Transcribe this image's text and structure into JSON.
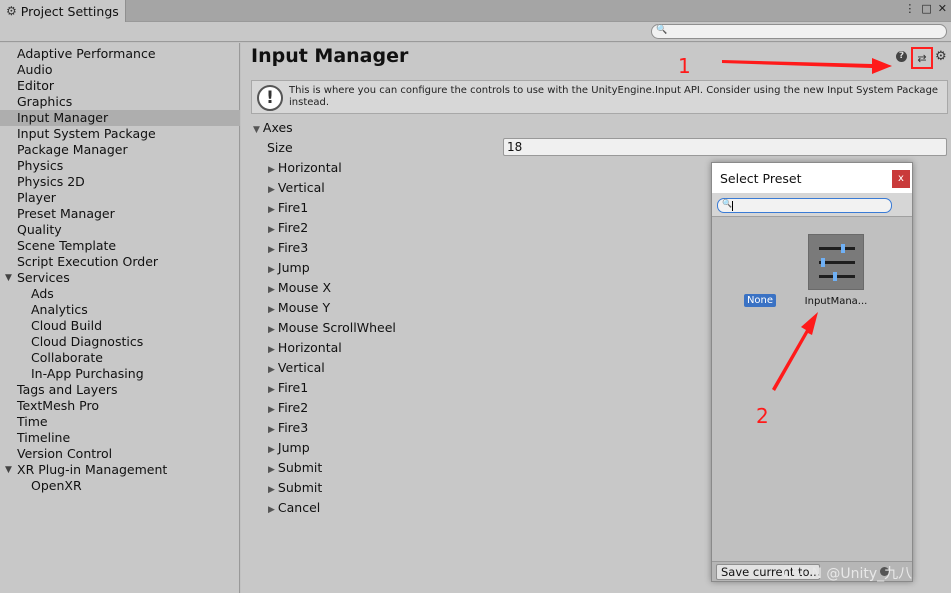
{
  "window": {
    "tab_title": "Project Settings",
    "tab_icon": "gear-icon",
    "controls": [
      "⋮",
      "□",
      "✕"
    ]
  },
  "search": {
    "placeholder": ""
  },
  "sidebar": {
    "items": [
      {
        "label": "Adaptive Performance",
        "indent": 0
      },
      {
        "label": "Audio",
        "indent": 0
      },
      {
        "label": "Editor",
        "indent": 0
      },
      {
        "label": "Graphics",
        "indent": 0
      },
      {
        "label": "Input Manager",
        "indent": 0,
        "selected": true
      },
      {
        "label": "Input System Package",
        "indent": 0
      },
      {
        "label": "Package Manager",
        "indent": 0
      },
      {
        "label": "Physics",
        "indent": 0
      },
      {
        "label": "Physics 2D",
        "indent": 0
      },
      {
        "label": "Player",
        "indent": 0
      },
      {
        "label": "Preset Manager",
        "indent": 0
      },
      {
        "label": "Quality",
        "indent": 0
      },
      {
        "label": "Scene Template",
        "indent": 0
      },
      {
        "label": "Script Execution Order",
        "indent": 0
      },
      {
        "label": "Services",
        "indent": 0,
        "expanded": true
      },
      {
        "label": "Ads",
        "indent": 1
      },
      {
        "label": "Analytics",
        "indent": 1
      },
      {
        "label": "Cloud Build",
        "indent": 1
      },
      {
        "label": "Cloud Diagnostics",
        "indent": 1
      },
      {
        "label": "Collaborate",
        "indent": 1
      },
      {
        "label": "In-App Purchasing",
        "indent": 1
      },
      {
        "label": "Tags and Layers",
        "indent": 0
      },
      {
        "label": "TextMesh Pro",
        "indent": 0
      },
      {
        "label": "Time",
        "indent": 0
      },
      {
        "label": "Timeline",
        "indent": 0
      },
      {
        "label": "Version Control",
        "indent": 0
      },
      {
        "label": "XR Plug-in Management",
        "indent": 0,
        "expanded": true
      },
      {
        "label": "OpenXR",
        "indent": 1
      }
    ]
  },
  "main": {
    "title": "Input Manager",
    "info_message": "This is where you can configure the controls to use with the UnityEngine.Input API. Consider using the new Input System Package instead.",
    "axes_label": "Axes",
    "size_label": "Size",
    "size_value": "18",
    "axes": [
      "Horizontal",
      "Vertical",
      "Fire1",
      "Fire2",
      "Fire3",
      "Jump",
      "Mouse X",
      "Mouse Y",
      "Mouse ScrollWheel",
      "Horizontal",
      "Vertical",
      "Fire1",
      "Fire2",
      "Fire3",
      "Jump",
      "Submit",
      "Submit",
      "Cancel"
    ]
  },
  "preset_dialog": {
    "title": "Select Preset",
    "close_label": "x",
    "none_label": "None",
    "preset_name": "InputMana...",
    "save_label": "Save current to..."
  },
  "annotations": {
    "marker_1": "1",
    "marker_2": "2",
    "color": "#ff1a1a"
  },
  "watermark": "CSDN @Unity_九八"
}
